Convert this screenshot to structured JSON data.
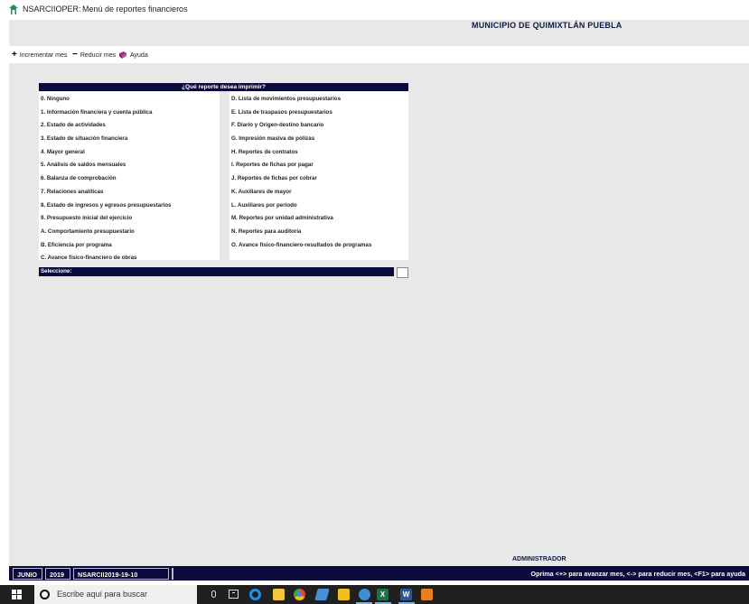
{
  "window": {
    "app_name": "NSARCIIOPER:",
    "title": "Menú de reportes financieros"
  },
  "header": {
    "municipality": "MUNICIPIO DE QUIMIXTLÁN PUEBLA"
  },
  "toolbar": {
    "increment_label": "Incrementar mes",
    "decrement_label": "Reducir mes",
    "help_label": "Ayuda"
  },
  "dialog": {
    "title": "¿Qué reporte desea imprimir?",
    "left_options": [
      "0. Ninguno",
      "1. Información financiera y cuenta pública",
      "2. Estado de actividades",
      "3. Estado de situación financiera",
      "4. Mayor general",
      "5. Análisis de saldos mensuales",
      "6. Balanza de comprobación",
      "7. Relaciones analíticas",
      "8. Estado de ingresos y egresos presupuestarios",
      "9. Presupuesto inicial del ejercicio",
      "A. Comportamiento presupuestario",
      "B. Eficiencia por programa",
      "C. Avance físico-financiero de obras"
    ],
    "right_options": [
      "D. Lista de movimientos presupuestarios",
      "E. Lista de traspasos presupuestarios",
      "F. Diario y Origen-destino bancario",
      "G. Impresión masiva de pólizas",
      "H. Reportes de contratos",
      "I. Reportes de fichas por pagar",
      "J. Reportes de fichas por cobrar",
      "K. Auxiliares de mayor",
      "L. Auxiliares por periodo",
      "M. Reportes por unidad administrativa",
      "N. Reportes para auditoría",
      "O. Avance físico-financiero-resultados de programas"
    ],
    "select_label": "Seleccione:",
    "select_value": ""
  },
  "status": {
    "user": "ADMINISTRADOR",
    "month": "JUNIO",
    "year": "2019",
    "database": "NSARCII2019-19-10",
    "help_text": "Oprima <+> para avanzar mes, <-> para reducir mes, <F1> para ayuda"
  },
  "taskbar": {
    "search_placeholder": "Escribe aquí para buscar"
  },
  "colors": {
    "dialog_bar": "#0a0a3c",
    "workspace": "#e8e8e8",
    "taskbar": "#202020"
  }
}
